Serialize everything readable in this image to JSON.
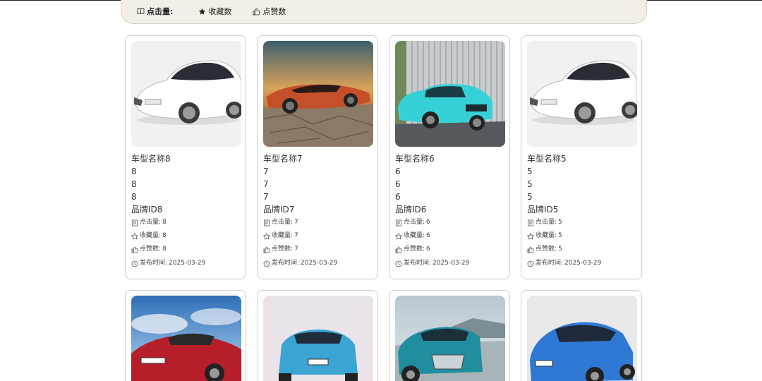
{
  "sort_bar": {
    "click_label": "点击量:",
    "collect_label": "收藏数",
    "like_label": "点赞数"
  },
  "card_labels": {
    "clicks": "点击量:",
    "collects": "收藏量:",
    "likes": "点赞数:",
    "publish": "发布时间:"
  },
  "cards": [
    {
      "name": "车型名称8",
      "f1": "8",
      "f2": "8",
      "f3": "8",
      "brand": "品牌ID8",
      "clicks": "8",
      "collects": "8",
      "likes": "8",
      "date": "2025-03-29",
      "image": "white-car-photo"
    },
    {
      "name": "车型名称7",
      "f1": "7",
      "f2": "7",
      "f3": "7",
      "brand": "品牌ID7",
      "clicks": "7",
      "collects": "7",
      "likes": "7",
      "date": "2025-03-29",
      "image": "orange-convertible-photo"
    },
    {
      "name": "车型名称6",
      "f1": "6",
      "f2": "6",
      "f3": "6",
      "brand": "品牌ID6",
      "clicks": "6",
      "collects": "6",
      "likes": "6",
      "date": "2025-03-29",
      "image": "cyan-suv-photo"
    },
    {
      "name": "车型名称5",
      "f1": "5",
      "f2": "5",
      "f3": "5",
      "brand": "品牌ID5",
      "clicks": "5",
      "collects": "5",
      "likes": "5",
      "date": "2025-03-29",
      "image": "white-car-photo"
    },
    {
      "image": "red-coupe-photo"
    },
    {
      "image": "blue-sedan-photo"
    },
    {
      "image": "teal-audi-suv-photo"
    },
    {
      "image": "blue-hatchback-photo"
    }
  ],
  "colors": {
    "sort_bar_bg": "#f3efe6",
    "card_border": "#cfcfcf"
  }
}
